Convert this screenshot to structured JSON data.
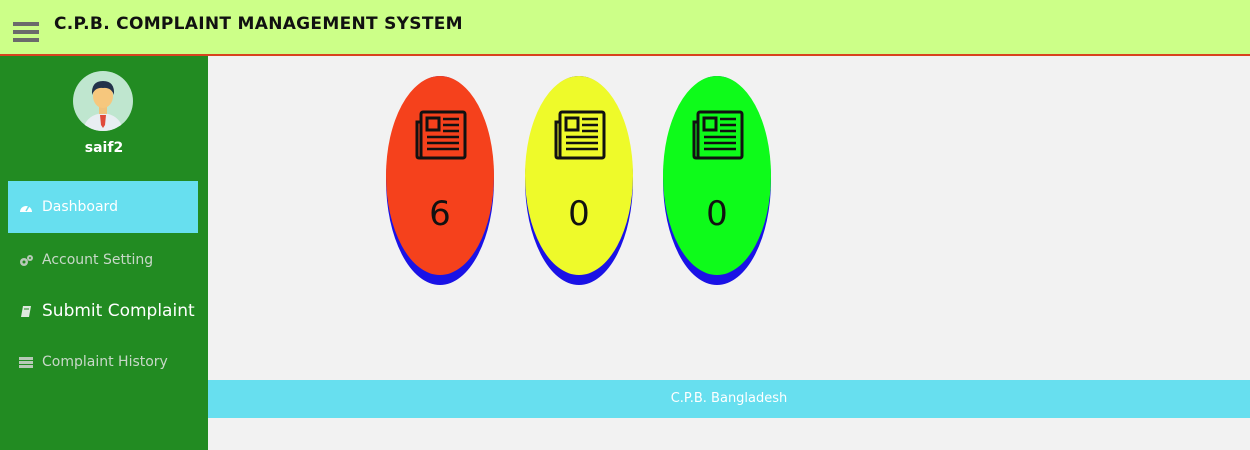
{
  "header": {
    "title": "C.P.B. COMPLAINT MANAGEMENT SYSTEM",
    "bar_color": "#ccff88"
  },
  "sidebar": {
    "username": "saif2",
    "items": [
      {
        "label": "Dashboard",
        "icon": "dashboard-icon",
        "active": true
      },
      {
        "label": "Account Setting",
        "icon": "gears-icon"
      },
      {
        "label": "Submit Complaint",
        "icon": "book-icon"
      },
      {
        "label": "Complaint History",
        "icon": "list-icon"
      }
    ]
  },
  "stats": [
    {
      "count": "6",
      "color": "#f5411c",
      "icon": "newspaper-icon"
    },
    {
      "count": "0",
      "color": "#eefa2a",
      "icon": "newspaper-icon"
    },
    {
      "count": "0",
      "color": "#0efb1a",
      "icon": "newspaper-icon"
    }
  ],
  "footer": {
    "text": "C.P.B. Bangladesh"
  }
}
